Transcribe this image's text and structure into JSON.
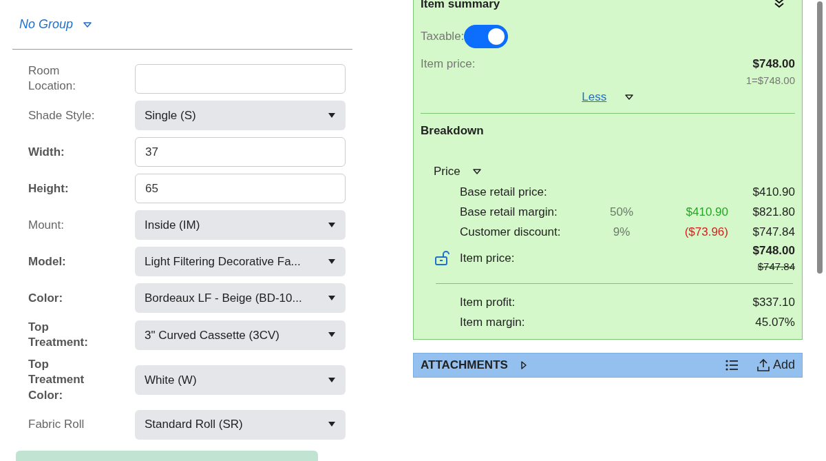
{
  "group": {
    "label": "No Group"
  },
  "fields": [
    {
      "label": "Room Location:",
      "kind": "text",
      "required": false
    },
    {
      "label": "Shade Style:",
      "kind": "select",
      "value": "Single (S)",
      "required": false
    },
    {
      "label": "Width:",
      "kind": "text",
      "value": "37",
      "required": true
    },
    {
      "label": "Height:",
      "kind": "text",
      "value": "65",
      "required": true
    },
    {
      "label": "Mount:",
      "kind": "select",
      "value": "Inside (IM)",
      "required": false
    },
    {
      "label": "Model:",
      "kind": "select",
      "value": "Light Filtering Decorative Fa...",
      "required": true
    },
    {
      "label": "Color:",
      "kind": "select",
      "value": "Bordeaux LF - Beige (BD-10...",
      "required": true
    },
    {
      "label": "Top Treatment:",
      "kind": "select",
      "value": "3\" Curved Cassette (3CV)",
      "required": true
    },
    {
      "label": "Top Treatment Color:",
      "kind": "select",
      "value": "White (W)",
      "required": true
    },
    {
      "label": "Fabric Roll",
      "kind": "select",
      "value": "Standard Roll (SR)",
      "required": false
    }
  ],
  "toast": {
    "visible": true
  },
  "item_summary": {
    "title": "Item summary",
    "taxable": {
      "label": "Taxable:",
      "on": true
    },
    "item_price": {
      "label": "Item price:",
      "value": "$748.00",
      "per_unit": "1=$748.00"
    },
    "less_link": "Less",
    "breakdown": {
      "title": "Breakdown",
      "section": "Price",
      "expanded": true,
      "rows": [
        {
          "label": "Base retail price:",
          "value": "$410.90"
        },
        {
          "label": "Base retail margin:",
          "percent": "50%",
          "amount": "$410.90",
          "color": "#28a428",
          "value": "$821.80"
        },
        {
          "label": "Customer discount:",
          "percent": "9%",
          "amount": "($73.96)",
          "color": "#d62020",
          "value": "$747.84"
        }
      ],
      "item_price": {
        "label": "Item price:",
        "value": "$748.00",
        "original": "$747.84",
        "locked": false
      },
      "totals": [
        {
          "label": "Item profit:",
          "value": "$337.10"
        },
        {
          "label": "Item margin:",
          "value": "45.07%"
        }
      ]
    }
  },
  "attachments": {
    "title": "ATTACHMENTS",
    "expanded": false,
    "add": "Add"
  }
}
